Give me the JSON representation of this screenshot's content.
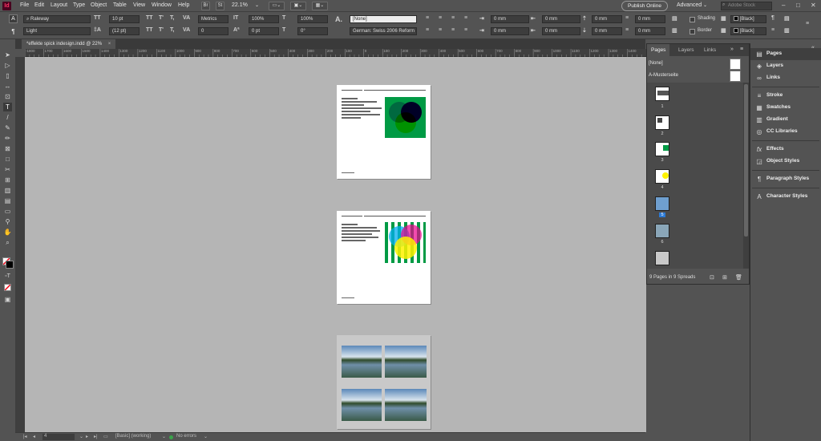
{
  "app": {
    "logo": "Id"
  },
  "menu": [
    "File",
    "Edit",
    "Layout",
    "Type",
    "Object",
    "Table",
    "View",
    "Window",
    "Help"
  ],
  "menubar": {
    "br_label": "Br",
    "st_label": "St",
    "zoom": "22.1%",
    "publish_label": "Publish Online",
    "workspace": "Advanced",
    "search_placeholder": "Adobe Stock"
  },
  "control": {
    "font_family": "Raleway",
    "font_style": "Light",
    "font_size": "10 pt",
    "leading": "(12 pt)",
    "kerning": "Metrics",
    "tracking": "0",
    "vscale": "100%",
    "hscale": "100%",
    "baseline": "0 pt",
    "skew": "0°",
    "char_style": "[None]",
    "language": "German: Swiss 2006 Reform",
    "indent_fields": [
      "0 mm",
      "0 mm",
      "0 mm",
      "0 mm",
      "0 mm",
      "0 mm",
      "0 mm",
      "0 mm"
    ],
    "shading_label": "Shading",
    "border_label": "Border",
    "swatch1": "[Black]",
    "swatch2": "[Black]",
    "tt_labels": [
      "TT",
      "T'",
      "T,",
      "TT",
      "T'",
      "T,"
    ]
  },
  "document": {
    "tab_title": "*effekte spick indesign.indd @ 22%",
    "tab_close": "×"
  },
  "ruler": [
    "-1800",
    "1700",
    "1600",
    "1500",
    "1400",
    "1300",
    "1200",
    "1100",
    "1000",
    "900",
    "800",
    "700",
    "600",
    "500",
    "400",
    "300",
    "200",
    "100",
    "0",
    "100",
    "200",
    "300",
    "400",
    "500",
    "600",
    "700",
    "800",
    "900",
    "1000",
    "1100",
    "1200",
    "1300",
    "1400"
  ],
  "status": {
    "page_number": "4",
    "profile": "[Basic] (working)",
    "errors": "No errors"
  },
  "pages_panel": {
    "tabs": [
      "Pages",
      "Layers",
      "Links"
    ],
    "masters": [
      "[None]",
      "A-Musterseite"
    ],
    "page_numbers": [
      "1",
      "2",
      "3",
      "4",
      "5",
      "6"
    ],
    "selected_page": "5",
    "footer": "9 Pages in 9 Spreads"
  },
  "dock": [
    {
      "label": "Pages",
      "icon": "pages-icon"
    },
    {
      "label": "Layers",
      "icon": "layers-icon"
    },
    {
      "label": "Links",
      "icon": "links-icon"
    },
    {
      "label": "Stroke",
      "icon": "stroke-icon"
    },
    {
      "label": "Swatches",
      "icon": "swatches-icon"
    },
    {
      "label": "Gradient",
      "icon": "gradient-icon"
    },
    {
      "label": "CC Libraries",
      "icon": "cc-libraries-icon"
    },
    {
      "label": "Effects",
      "icon": "effects-icon"
    },
    {
      "label": "Object Styles",
      "icon": "object-styles-icon"
    },
    {
      "label": "Paragraph Styles",
      "icon": "paragraph-styles-icon"
    },
    {
      "label": "Character Styles",
      "icon": "character-styles-icon"
    }
  ],
  "colors": {
    "bg": "#535353",
    "pasteboard": "#b5b5b5",
    "green": "#009a44",
    "cyan": "#00aeef",
    "magenta": "#ec008c",
    "yellow": "#fff200",
    "brand": "#ff3366",
    "selected": "#2d7ad4"
  }
}
